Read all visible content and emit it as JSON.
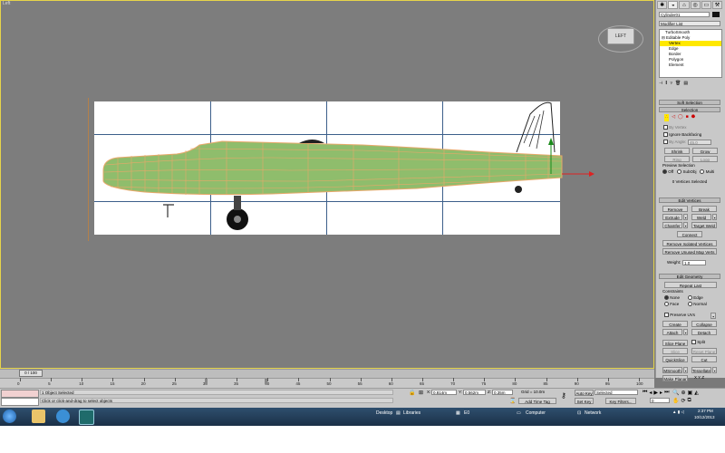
{
  "viewport": {
    "label": "Left",
    "viewcube_label": "LEFT"
  },
  "command_panel": {
    "object_name": "Cylinder01",
    "modifier_list": "Modifier List",
    "stack": [
      {
        "label": "TurboSmooth",
        "selected": false
      },
      {
        "label": "Editable Poly",
        "selected": false
      },
      {
        "label": "Vertex",
        "selected": true
      },
      {
        "label": "Edge",
        "selected": false
      },
      {
        "label": "Border",
        "selected": false
      },
      {
        "label": "Polygon",
        "selected": false
      },
      {
        "label": "Element",
        "selected": false
      }
    ],
    "soft_selection": "Soft Selection",
    "selection": {
      "title": "Selection",
      "by_vertex": "By Vertex",
      "ignore_backfacing": "Ignore Backfacing",
      "by_angle": "By Angle:",
      "by_angle_value": "45.0",
      "shrink": "Shrink",
      "grow": "Grow",
      "ring": "Ring",
      "loop": "Loop",
      "preview_selection": "Preview Selection",
      "off": "Off",
      "subobj": "SubObj",
      "multi": "Multi",
      "status": "0 Vertices Selected"
    },
    "edit_vertices": {
      "title": "Edit Vertices",
      "remove": "Remove",
      "break": "Break",
      "extrude": "Extrude",
      "weld": "Weld",
      "chamfer": "Chamfer",
      "target_weld": "Target Weld",
      "connect": "Connect",
      "remove_isolated": "Remove Isolated Vertices",
      "remove_unused": "Remove Unused Map Verts",
      "weight": "Weight:",
      "weight_value": "1.0"
    },
    "edit_geometry": {
      "title": "Edit Geometry",
      "repeat_last": "Repeat Last",
      "constraints": "Constraints",
      "none": "None",
      "edge": "Edge",
      "face": "Face",
      "normal": "Normal",
      "preserve_uvs": "Preserve UVs",
      "create": "Create",
      "collapse": "Collapse",
      "attach": "Attach",
      "detach": "Detach",
      "slice_plane": "Slice Plane",
      "split": "Split",
      "slice": "Slice",
      "reset_plane": "Reset Plane",
      "quickslice": "QuickSlice",
      "cut": "Cut",
      "msmooth": "MSmooth",
      "tessellate": "Tessellate",
      "make_planar": "Make Planar",
      "xyz": "X Y Z"
    }
  },
  "timeline": {
    "slider": "0 / 100",
    "ticks": [
      "0",
      "5",
      "10",
      "15",
      "20",
      "25",
      "30",
      "35",
      "40",
      "45",
      "50",
      "55",
      "60",
      "65",
      "70",
      "75",
      "80",
      "85",
      "90",
      "95",
      "100"
    ]
  },
  "status": {
    "selected": "1 Object Selected",
    "prompt": "Click or click-and-drag to select objects",
    "x_label": "X:",
    "x": "0.814m",
    "y_label": "Y:",
    "y": "0.562m",
    "z_label": "Z:",
    "z": "0.35m",
    "grid": "Grid = 10.0m",
    "add_time_tag": "Add Time Tag",
    "auto_key": "Auto Key",
    "auto_key_mode": "Selected",
    "set_key": "Set Key",
    "key_filters": "Key Filters...",
    "frame": "0"
  },
  "taskbar": {
    "desktop": "Desktop",
    "libraries": "Libraries",
    "folder_e": "E0",
    "computer": "Computer",
    "network": "Network",
    "time": "2:37 PM",
    "date": "10/12/2013"
  },
  "colors": {
    "fuselage": "#8fbd6c",
    "wire": "#e8a86a",
    "selection_highlight": "#ffe800",
    "taskbar": "#1f3a56"
  }
}
